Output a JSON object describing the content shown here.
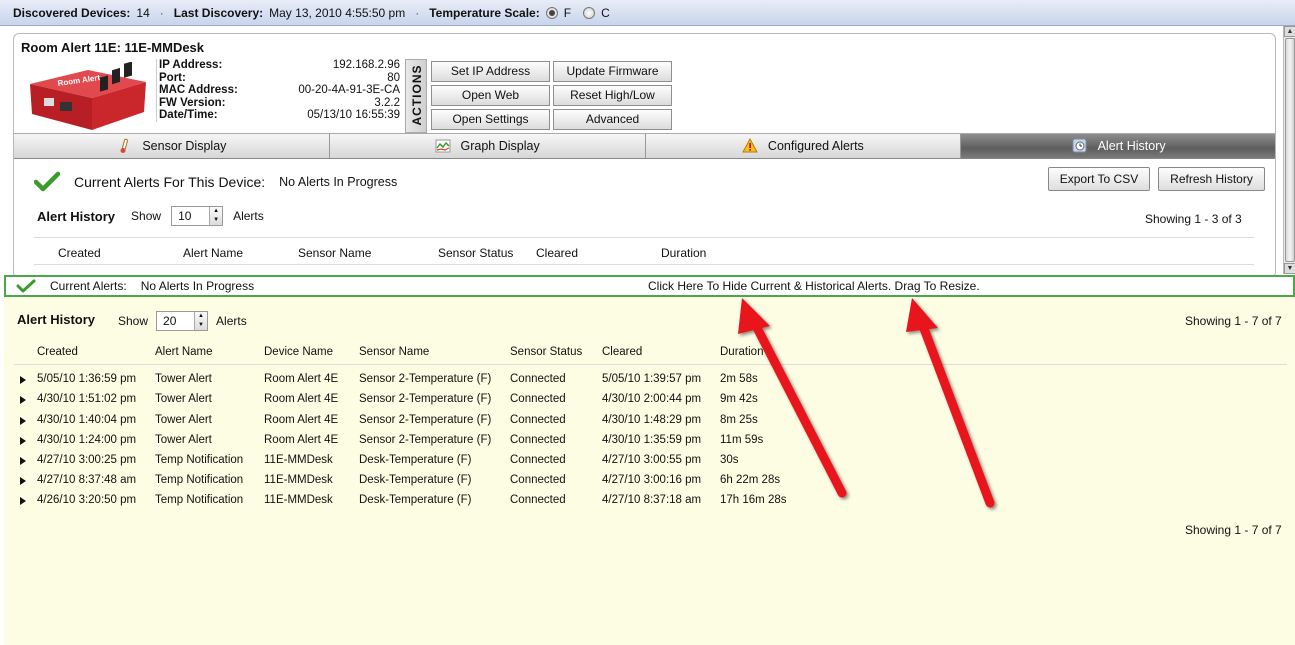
{
  "topbar": {
    "discovered_label": "Discovered Devices:",
    "discovered_count": "14",
    "last_discovery_label": "Last Discovery:",
    "last_discovery_value": "May 13, 2010  4:55:50 pm",
    "temp_scale_label": "Temperature Scale:",
    "scale_f": "F",
    "scale_c": "C",
    "scale_selected": "F"
  },
  "device": {
    "title": "Room Alert 11E:  11E-MMDesk",
    "info": [
      {
        "k": "IP Address:",
        "v": "192.168.2.96"
      },
      {
        "k": "Port:",
        "v": "80"
      },
      {
        "k": "MAC Address:",
        "v": "00-20-4A-91-3E-CA"
      },
      {
        "k": "FW Version:",
        "v": "3.2.2"
      },
      {
        "k": "Date/Time:",
        "v": "05/13/10 16:55:39"
      }
    ],
    "actions_label": "ACTIONS",
    "buttons": {
      "set_ip": "Set IP Address",
      "update_fw": "Update Firmware",
      "open_web": "Open Web",
      "reset_hilo": "Reset High/Low",
      "open_settings": "Open Settings",
      "advanced": "Advanced"
    }
  },
  "tabs": [
    {
      "label": "Sensor Display",
      "icon": "thermometer-icon"
    },
    {
      "label": "Graph Display",
      "icon": "graph-icon"
    },
    {
      "label": "Configured Alerts",
      "icon": "warning-icon"
    },
    {
      "label": "Alert History",
      "icon": "history-icon"
    }
  ],
  "active_tab": "Alert History",
  "panel": {
    "current_label": "Current Alerts For This Device:",
    "current_value": "No Alerts In Progress",
    "export_btn": "Export To CSV",
    "refresh_btn": "Refresh History",
    "history_title": "Alert History",
    "show_label": "Show",
    "show_value": "10",
    "alerts_label": "Alerts",
    "showing": "Showing  1 - 3  of  3",
    "columns": [
      "Created",
      "Alert Name",
      "Sensor Name",
      "Sensor Status",
      "Cleared",
      "Duration"
    ]
  },
  "drawer_bar": {
    "label": "Current Alerts:",
    "value": "No Alerts In Progress",
    "hint": "Click Here To Hide Current & Historical Alerts. Drag To Resize."
  },
  "drawer": {
    "title": "Alert History",
    "show_label": "Show",
    "show_value": "20",
    "alerts_label": "Alerts",
    "showing_top": "Showing  1 - 7  of  7",
    "showing_bottom": "Showing  1 - 7  of  7",
    "columns": [
      "Created",
      "Alert Name",
      "Device Name",
      "Sensor Name",
      "Sensor Status",
      "Cleared",
      "Duration"
    ],
    "rows": [
      [
        "5/05/10 1:36:59 pm",
        "Tower Alert",
        "Room Alert 4E",
        "Sensor 2-Temperature (F)",
        "Connected",
        "5/05/10 1:39:57 pm",
        "2m 58s"
      ],
      [
        "4/30/10 1:51:02 pm",
        "Tower Alert",
        "Room Alert 4E",
        "Sensor 2-Temperature (F)",
        "Connected",
        "4/30/10 2:00:44 pm",
        "9m 42s"
      ],
      [
        "4/30/10 1:40:04 pm",
        "Tower Alert",
        "Room Alert 4E",
        "Sensor 2-Temperature (F)",
        "Connected",
        "4/30/10 1:48:29 pm",
        "8m 25s"
      ],
      [
        "4/30/10 1:24:00 pm",
        "Tower Alert",
        "Room Alert 4E",
        "Sensor 2-Temperature (F)",
        "Connected",
        "4/30/10 1:35:59 pm",
        "11m 59s"
      ],
      [
        "4/27/10 3:00:25 pm",
        "Temp Notification",
        "11E-MMDesk",
        "Desk-Temperature (F)",
        "Connected",
        "4/27/10 3:00:55 pm",
        "30s"
      ],
      [
        "4/27/10 8:37:48 am",
        "Temp Notification",
        "11E-MMDesk",
        "Desk-Temperature (F)",
        "Connected",
        "4/27/10 3:00:16 pm",
        "6h 22m 28s"
      ],
      [
        "4/26/10 3:20:50 pm",
        "Temp Notification",
        "11E-MMDesk",
        "Desk-Temperature (F)",
        "Connected",
        "4/27/10 8:37:18 am",
        "17h 16m 28s"
      ]
    ]
  },
  "colors": {
    "drawer_bg": "#fdfde3",
    "drawer_border": "#4aa84a",
    "annotation_arrow": "#e8121b",
    "device_red": "#c8262b"
  },
  "device_image_text": "Room Alert"
}
